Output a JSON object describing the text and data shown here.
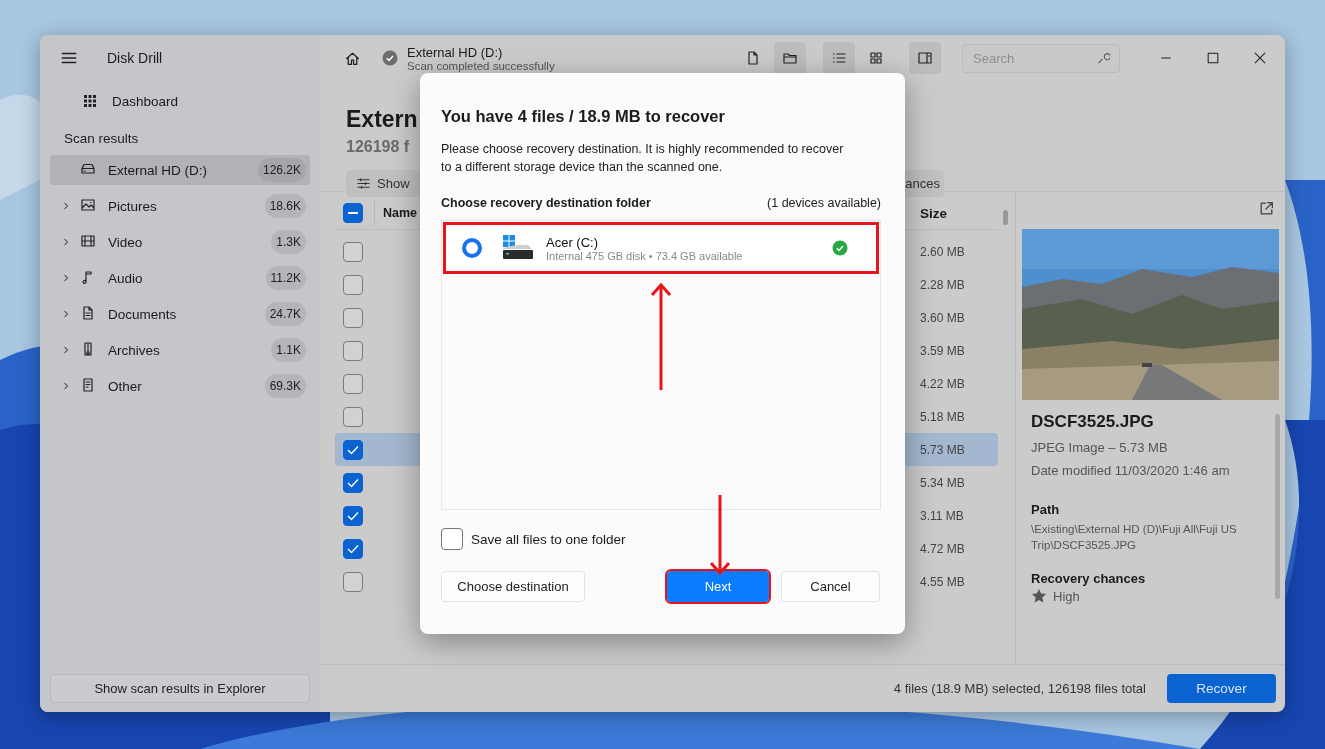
{
  "sidebar": {
    "app_title": "Disk Drill",
    "dashboard": "Dashboard",
    "section_title": "Scan results",
    "items": [
      {
        "label": "External HD (D:)",
        "count": "126.2K",
        "selected": true,
        "expandable": false
      },
      {
        "label": "Pictures",
        "count": "18.6K",
        "selected": false,
        "expandable": true
      },
      {
        "label": "Video",
        "count": "1.3K",
        "selected": false,
        "expandable": true
      },
      {
        "label": "Audio",
        "count": "11.2K",
        "selected": false,
        "expandable": true
      },
      {
        "label": "Documents",
        "count": "24.7K",
        "selected": false,
        "expandable": true
      },
      {
        "label": "Archives",
        "count": "1.1K",
        "selected": false,
        "expandable": true
      },
      {
        "label": "Other",
        "count": "69.3K",
        "selected": false,
        "expandable": true
      }
    ],
    "explorer_button": "Show scan results in Explorer"
  },
  "toolbar": {
    "title": "External HD (D:)",
    "subtitle": "Scan completed successfully",
    "view_buttons": [
      {
        "selected": false
      },
      {
        "selected": true
      },
      {
        "selected": true
      },
      {
        "selected": false
      },
      {
        "selected": true
      }
    ],
    "search": {
      "placeholder": "Search"
    }
  },
  "header": {
    "title": "Extern",
    "subtitle": "126198 f",
    "filters": [
      {
        "label": "Show"
      },
      {
        "label": "ances"
      }
    ]
  },
  "table": {
    "columns": [
      "Name",
      "Size"
    ],
    "select_all": {
      "indeterminate": true
    },
    "rows": [
      {
        "checked": false,
        "selected": false,
        "size": "2.60 MB"
      },
      {
        "checked": false,
        "selected": false,
        "size": "2.28 MB"
      },
      {
        "checked": false,
        "selected": false,
        "size": "3.60 MB"
      },
      {
        "checked": false,
        "selected": false,
        "size": "3.59 MB"
      },
      {
        "checked": false,
        "selected": false,
        "size": "4.22 MB"
      },
      {
        "checked": false,
        "selected": false,
        "size": "5.18 MB"
      },
      {
        "checked": true,
        "selected": true,
        "size": "5.73 MB"
      },
      {
        "checked": true,
        "selected": false,
        "size": "5.34 MB"
      },
      {
        "checked": true,
        "selected": false,
        "size": "3.11 MB"
      },
      {
        "checked": true,
        "selected": false,
        "size": "4.72 MB"
      },
      {
        "checked": false,
        "selected": false,
        "size": "4.55 MB"
      }
    ]
  },
  "preview": {
    "file_name": "DSCF3525.JPG",
    "type_size": "JPEG Image – 5.73 MB",
    "date_modified": "Date modified 11/03/2020 1:46 am",
    "path_label": "Path",
    "path": "\\Existing\\External HD (D)\\Fuji All\\Fuji US Trip\\DSCF3525.JPG",
    "chances_label": "Recovery chances",
    "chances": "High"
  },
  "status_bar": {
    "summary": "4 files (18.9 MB) selected, 126198 files total",
    "recover_button": "Recover"
  },
  "dialog": {
    "title": "You have 4 files / 18.9 MB to recover",
    "description": "Please choose recovery destination. It is highly recommended to recover to a different storage device than the scanned one.",
    "list_title": "Choose recovery destination folder",
    "devices_available": "(1 devices available)",
    "devices": [
      {
        "name": "Acer (C:)",
        "details": "Internal 475 GB disk • 73.4 GB available",
        "selected": true,
        "healthy": true
      }
    ],
    "save_to_one_folder": {
      "label": "Save all files to one folder",
      "checked": false
    },
    "buttons": [
      {
        "label": "Choose destination",
        "kind": "secondary"
      },
      {
        "label": "Next",
        "kind": "primary"
      },
      {
        "label": "Cancel",
        "kind": "secondary"
      }
    ]
  }
}
